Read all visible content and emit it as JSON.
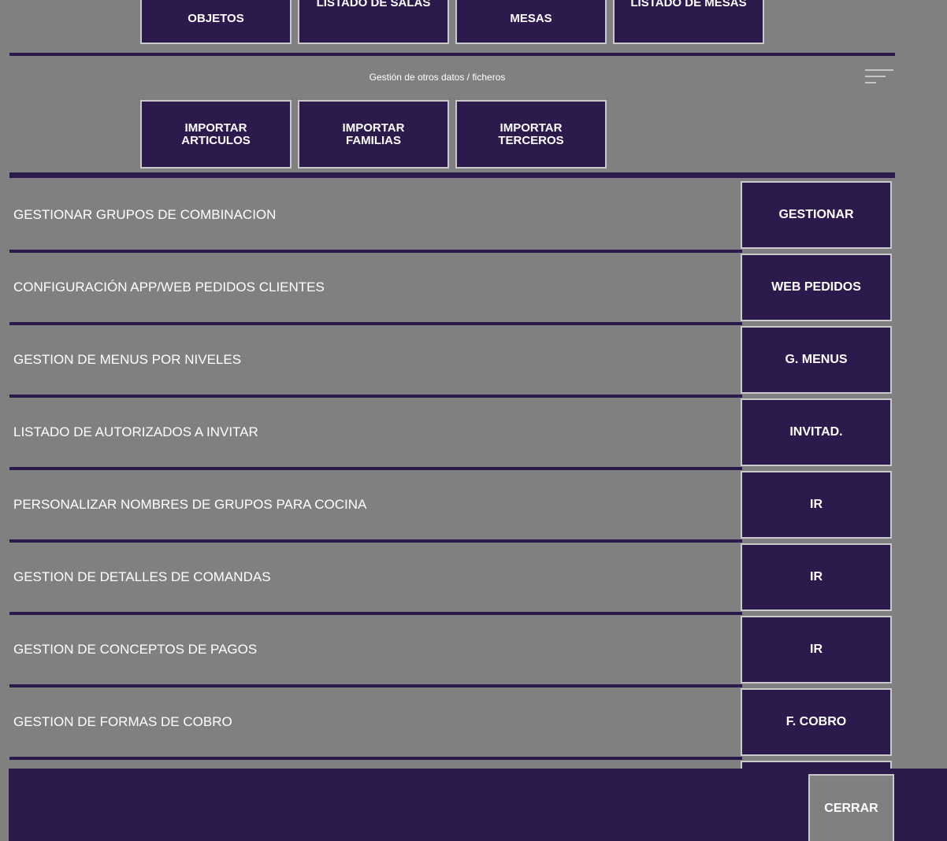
{
  "top_tiles": [
    "OBJETOS",
    "LISTADO DE SALAS",
    "MESAS",
    "LISTADO DE MESAS"
  ],
  "section": {
    "title": "Gestión de otros datos / ficheros",
    "import_tiles": [
      "IMPORTAR\nARTICULOS",
      "IMPORTAR\nFAMILIAS",
      "IMPORTAR\nTERCEROS"
    ]
  },
  "rows": [
    {
      "label": "GESTIONAR GRUPOS DE COMBINACION",
      "button": "GESTIONAR"
    },
    {
      "label": "CONFIGURACIÓN APP/WEB PEDIDOS CLIENTES",
      "button": "WEB PEDIDOS"
    },
    {
      "label": "GESTION DE MENUS POR NIVELES",
      "button": "G. MENUS"
    },
    {
      "label": "LISTADO DE AUTORIZADOS A INVITAR",
      "button": "INVITAD."
    },
    {
      "label": "PERSONALIZAR NOMBRES DE GRUPOS PARA COCINA",
      "button": "IR"
    },
    {
      "label": "GESTION DE DETALLES DE COMANDAS",
      "button": "IR"
    },
    {
      "label": "GESTION DE CONCEPTOS DE PAGOS",
      "button": "IR"
    },
    {
      "label": "GESTION DE FORMAS DE COBRO",
      "button": "F. COBRO"
    }
  ],
  "footer": {
    "close_label": "CERRAR"
  },
  "colors": {
    "accent": "#2d1a4d",
    "background": "#808080",
    "border": "#c9c9c9",
    "text": "#ffffff"
  }
}
